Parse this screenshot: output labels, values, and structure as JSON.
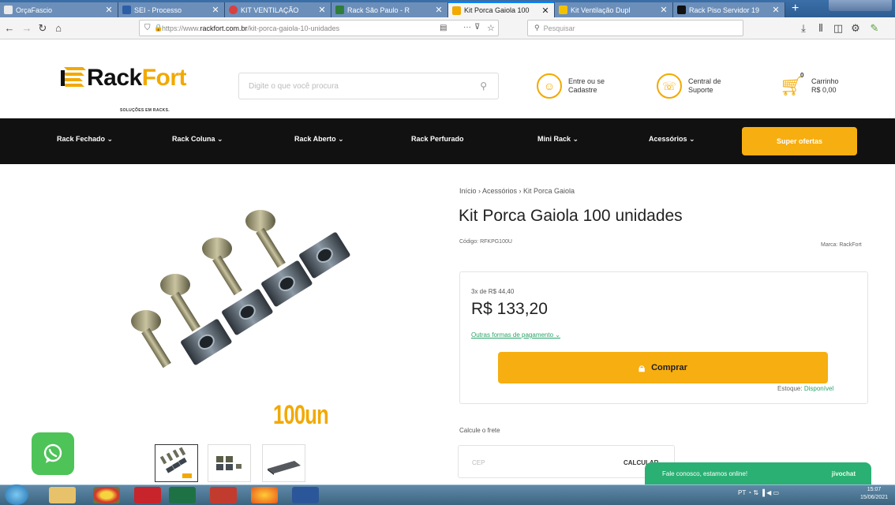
{
  "browser": {
    "tabs": [
      {
        "label": "OrçaFascio",
        "icon_color": "#e9e9e9"
      },
      {
        "label": "SEI - Processo",
        "icon_color": "#2b5ea7"
      },
      {
        "label": "KIT VENTILAÇÃO",
        "icon_color": "#d94040"
      },
      {
        "label": "Rack São Paulo - R",
        "icon_color": "#2f7d3a"
      },
      {
        "label": "Kit Porca Gaiola 100",
        "icon_color": "#f2a900"
      },
      {
        "label": "Kit Ventilação Dupl",
        "icon_color": "#f2c200"
      },
      {
        "label": "Rack Piso Servidor 19",
        "icon_color": "#111111"
      }
    ],
    "close_glyph": "✕",
    "new_tab_glyph": "+",
    "url_prefix": "https://www.",
    "url_domain": "rackfort.com.br",
    "url_path": "/kit-porca-gaiola-10-unidades",
    "search_placeholder": "Pesquisar"
  },
  "site": {
    "logo_part1": "Rack",
    "logo_part2": "Fort",
    "logo_tagline": "SOLUÇÕES EM RACKS.",
    "search_placeholder": "Digite o que você procura",
    "login_line1": "Entre ou se",
    "login_line2": "Cadastre",
    "support_line1": "Central de",
    "support_line2": "Suporte",
    "cart_label": "Carrinho",
    "cart_total": "R$ 0,00",
    "cart_count": "0",
    "brand_color": "#f2a900"
  },
  "categories": [
    {
      "label": "Rack Fechado ⌄"
    },
    {
      "label": "Rack Coluna ⌄"
    },
    {
      "label": "Rack Aberto ⌄"
    },
    {
      "label": "Rack Perfurado"
    },
    {
      "label": "Mini Rack ⌄"
    },
    {
      "label": "Acessórios ⌄"
    }
  ],
  "super_offers": "Super ofertas",
  "product": {
    "breadcrumb": "Início › Acessórios › Kit Porca Gaiola",
    "title": "Kit Porca Gaiola 100 unidades",
    "code": "Código: RFKPG100U",
    "brand": "Marca: RackFort",
    "image_label": "100un",
    "installments": "3x de R$ 44,40",
    "price": "R$ 133,20",
    "payment_options": "Outras formas de pagamento ⌄",
    "buy_label": "Comprar",
    "stock_label": "Estoque:",
    "stock_value": "Disponível",
    "shipping_label": "Calcule o frete",
    "cep_placeholder": "CEP",
    "calc_label": "CALCULAR"
  },
  "chat": {
    "message": "Fale conosco, estamos online!",
    "brand": "jivochat"
  },
  "taskbar": {
    "time": "15:07",
    "date": "15/06/2021"
  }
}
